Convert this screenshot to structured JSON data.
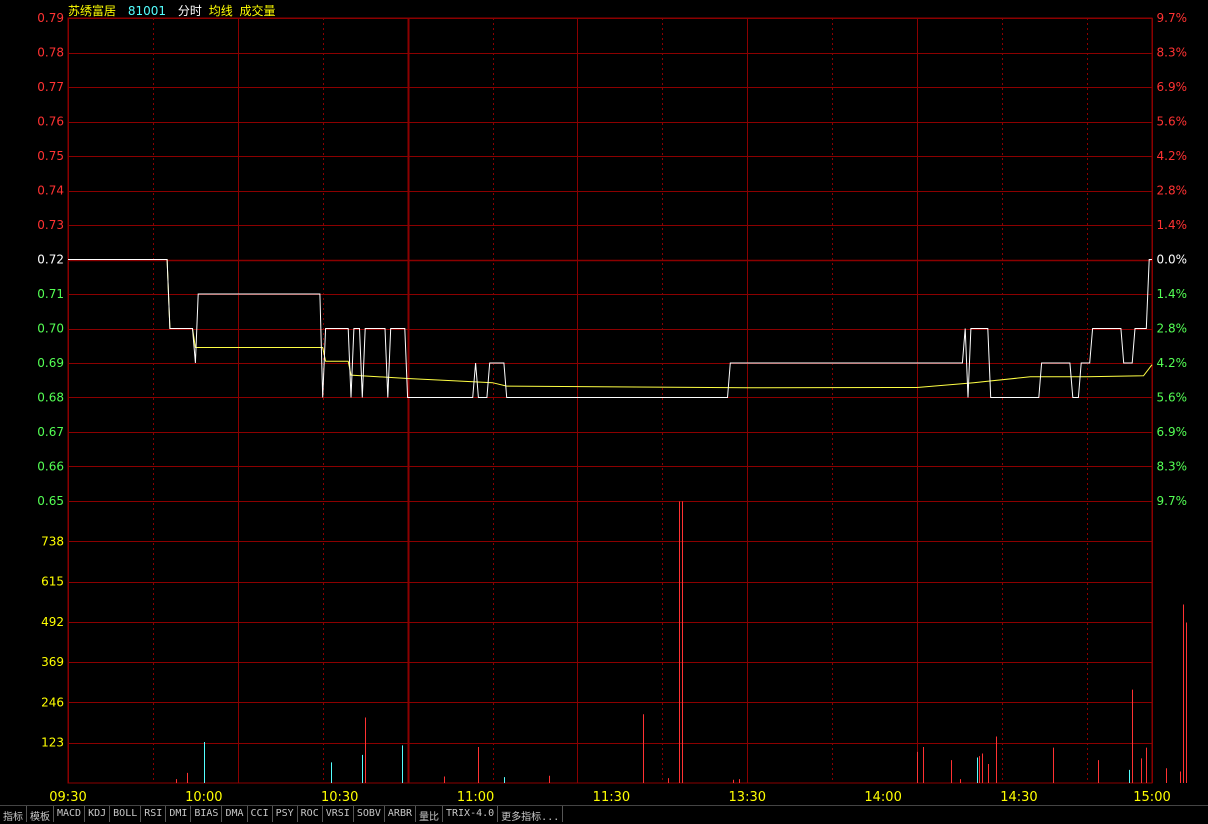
{
  "header": {
    "stock_name": "苏绣富居",
    "code": "81001",
    "items": [
      "分时",
      "均线",
      "成交量"
    ]
  },
  "colors": {
    "grid": "#8b0000",
    "up": "#ff3232",
    "down": "#54ff54",
    "price_line": "#ffffff",
    "avg_line": "#ffff44",
    "axis_text_vol": "#ffff00",
    "header_name": "#ffff00",
    "header_code": "#54ffff"
  },
  "chart_data": [
    {
      "type": "line",
      "prev_close": 0.72,
      "x": [
        "09:30",
        "10:00",
        "10:30",
        "11:00",
        "11:30",
        "13:30",
        "14:00",
        "14:30",
        "15:00"
      ],
      "y_ticks_left": [
        "0.79",
        "0.78",
        "0.77",
        "0.76",
        "0.75",
        "0.74",
        "0.73",
        "0.72",
        "0.71",
        "0.70",
        "0.69",
        "0.68",
        "0.67",
        "0.66",
        "0.65"
      ],
      "y_ticks_right": [
        "9.7%",
        "8.3%",
        "6.9%",
        "5.6%",
        "4.2%",
        "2.8%",
        "1.4%",
        "0.0%",
        "1.4%",
        "2.8%",
        "4.2%",
        "5.6%",
        "6.9%",
        "8.3%",
        "9.7%"
      ],
      "ylim": [
        0.65,
        0.79
      ],
      "series": [
        {
          "points": [
            [
              0,
              0.72
            ],
            [
              35,
              0.72
            ],
            [
              36,
              0.7
            ],
            [
              44,
              0.7
            ],
            [
              45,
              0.69
            ],
            [
              46,
              0.71
            ],
            [
              89,
              0.71
            ],
            [
              90,
              0.68
            ],
            [
              91,
              0.7
            ],
            [
              99,
              0.7
            ],
            [
              100,
              0.68
            ],
            [
              101,
              0.7
            ],
            [
              103,
              0.7
            ],
            [
              104,
              0.68
            ],
            [
              105,
              0.7
            ],
            [
              112,
              0.7
            ],
            [
              113,
              0.68
            ],
            [
              114,
              0.7
            ],
            [
              119,
              0.7
            ],
            [
              120,
              0.68
            ],
            [
              143,
              0.68
            ],
            [
              144,
              0.69
            ],
            [
              145,
              0.68
            ],
            [
              148,
              0.68
            ],
            [
              149,
              0.69
            ],
            [
              154,
              0.69
            ],
            [
              155,
              0.68
            ],
            [
              233,
              0.68
            ],
            [
              234,
              0.69
            ],
            [
              316,
              0.69
            ],
            [
              317,
              0.7
            ],
            [
              318,
              0.68
            ],
            [
              319,
              0.7
            ],
            [
              325,
              0.7
            ],
            [
              326,
              0.68
            ],
            [
              343,
              0.68
            ],
            [
              344,
              0.69
            ],
            [
              354,
              0.69
            ],
            [
              355,
              0.68
            ],
            [
              357,
              0.68
            ],
            [
              358,
              0.69
            ],
            [
              361,
              0.69
            ],
            [
              362,
              0.7
            ],
            [
              372,
              0.7
            ],
            [
              373,
              0.69
            ],
            [
              376,
              0.69
            ],
            [
              377,
              0.7
            ],
            [
              381,
              0.7
            ],
            [
              382,
              0.72
            ],
            [
              383,
              0.72
            ]
          ]
        },
        {
          "points": [
            [
              0,
              0.72
            ],
            [
              35,
              0.72
            ],
            [
              36,
              0.7
            ],
            [
              44,
              0.7
            ],
            [
              45,
              0.6945
            ],
            [
              90,
              0.6945
            ],
            [
              91,
              0.6905
            ],
            [
              99,
              0.6905
            ],
            [
              100,
              0.6865
            ],
            [
              120,
              0.6855
            ],
            [
              150,
              0.6843
            ],
            [
              155,
              0.6833
            ],
            [
              240,
              0.6828
            ],
            [
              300,
              0.6829
            ],
            [
              320,
              0.6843
            ],
            [
              340,
              0.686
            ],
            [
              360,
              0.686
            ],
            [
              380,
              0.6863
            ],
            [
              383,
              0.6895
            ]
          ]
        }
      ]
    },
    {
      "type": "bar",
      "ylim": [
        0,
        861
      ],
      "y_ticks": [
        "123",
        "246",
        "369",
        "492",
        "615",
        "738"
      ],
      "series": [
        {
          "points": [
            [
              38,
              12
            ],
            [
              42,
              31
            ],
            [
              48,
              125,
              "down"
            ],
            [
              93,
              63,
              "down"
            ],
            [
              104,
              86,
              "down"
            ],
            [
              105,
              200
            ],
            [
              118,
              115,
              "down"
            ],
            [
              133,
              20
            ],
            [
              145,
              110
            ],
            [
              154,
              18,
              "down"
            ],
            [
              170,
              22
            ],
            [
              203,
              210
            ],
            [
              212,
              15
            ],
            [
              216,
              860
            ],
            [
              217,
              860
            ],
            [
              235,
              10
            ],
            [
              237,
              12
            ],
            [
              300,
              95
            ],
            [
              302,
              110
            ],
            [
              312,
              70
            ],
            [
              315,
              12
            ],
            [
              321,
              78,
              "down"
            ],
            [
              322,
              82
            ],
            [
              323,
              90
            ],
            [
              325,
              58
            ],
            [
              328,
              142
            ],
            [
              348,
              108
            ],
            [
              364,
              70
            ],
            [
              375,
              40,
              "down"
            ],
            [
              376,
              285
            ],
            [
              379,
              75
            ],
            [
              381,
              108
            ],
            [
              388,
              45
            ],
            [
              393,
              35
            ],
            [
              394,
              545
            ],
            [
              395,
              490
            ]
          ]
        }
      ]
    }
  ],
  "tabs": [
    "指标",
    "模板",
    "MACD",
    "KDJ",
    "BOLL",
    "RSI",
    "DMI",
    "BIAS",
    "DMA",
    "CCI",
    "PSY",
    "ROC",
    "VRSI",
    "SOBV",
    "ARBR",
    "量比",
    "TRIX-4.0",
    "更多指标..."
  ]
}
